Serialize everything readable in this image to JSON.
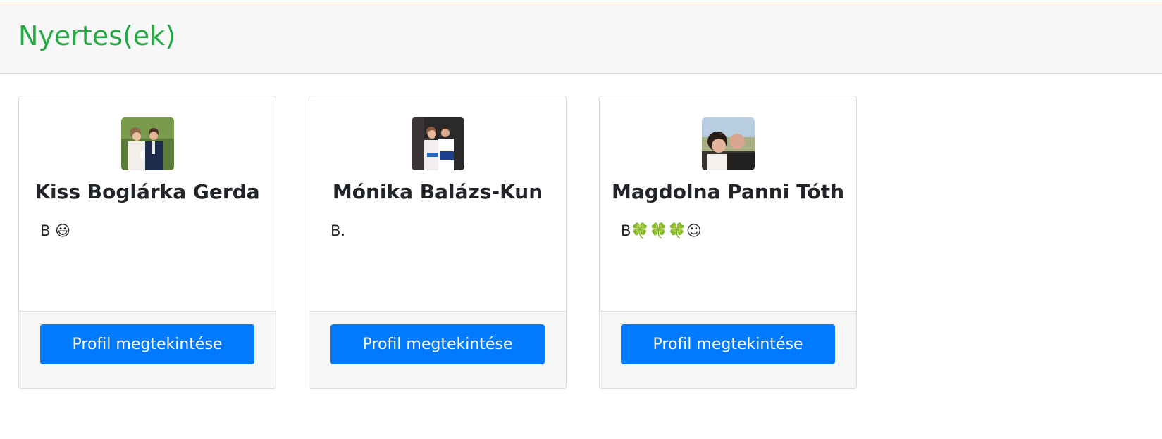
{
  "header": {
    "title": "Nyertes(ek)"
  },
  "winners": [
    {
      "name": "Kiss Boglárka Gerda",
      "comment": "B 😃",
      "button_label": "Profil megtekintése",
      "avatar": "couple-photo-green"
    },
    {
      "name": "Mónika Balázs-Kun",
      "comment": "B.",
      "button_label": "Profil megtekintése",
      "avatar": "couple-photo-dark"
    },
    {
      "name": "Magdolna Panni Tóth",
      "comment": "B🍀🍀🍀☺",
      "button_label": "Profil megtekintése",
      "avatar": "couple-selfie"
    }
  ],
  "colors": {
    "title": "#28a745",
    "button": "#007bff",
    "footer_bg": "#f7f7f7"
  }
}
